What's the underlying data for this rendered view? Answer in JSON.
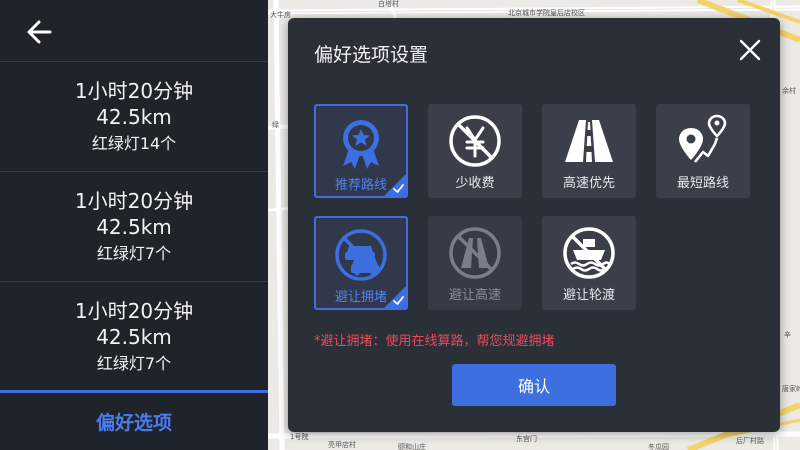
{
  "routes": [
    {
      "time": "1小时20分钟",
      "distance": "42.5km",
      "lights": "红绿灯14个"
    },
    {
      "time": "1小时20分钟",
      "distance": "42.5km",
      "lights": "红绿灯7个"
    },
    {
      "time": "1小时20分钟",
      "distance": "42.5km",
      "lights": "红绿灯7个"
    }
  ],
  "preferences_tab": "偏好选项",
  "map": {
    "labels": [
      "大牛房",
      "北京城市学院皇后店校区",
      "白塔村",
      "绿",
      "1号院",
      "亮甲店村",
      "颐和山庄",
      "东宫门",
      "冬瓜园",
      "后厂村路",
      "唐家岭",
      "辛",
      "余村"
    ]
  },
  "modal": {
    "title": "偏好选项设置",
    "options": [
      {
        "label": "推荐路线",
        "state": "selected",
        "icon": "award-star-icon"
      },
      {
        "label": "少收费",
        "state": "normal",
        "icon": "yen-coin-icon"
      },
      {
        "label": "高速优先",
        "state": "normal",
        "icon": "highway-icon"
      },
      {
        "label": "最短路线",
        "state": "normal",
        "icon": "route-pins-icon"
      },
      {
        "label": "避让拥堵",
        "state": "selected",
        "icon": "traffic-jam-icon"
      },
      {
        "label": "避让高速",
        "state": "disabled",
        "icon": "no-highway-icon"
      },
      {
        "label": "避让轮渡",
        "state": "normal",
        "icon": "no-ferry-icon"
      }
    ],
    "note": "*避让拥堵：使用在线算路，帮您规避拥堵",
    "confirm_label": "确认"
  },
  "colors": {
    "accent": "#3d6fe0",
    "warning": "#e94c5c",
    "panel_bg": "#1f232a",
    "modal_bg": "#2b2f37"
  }
}
